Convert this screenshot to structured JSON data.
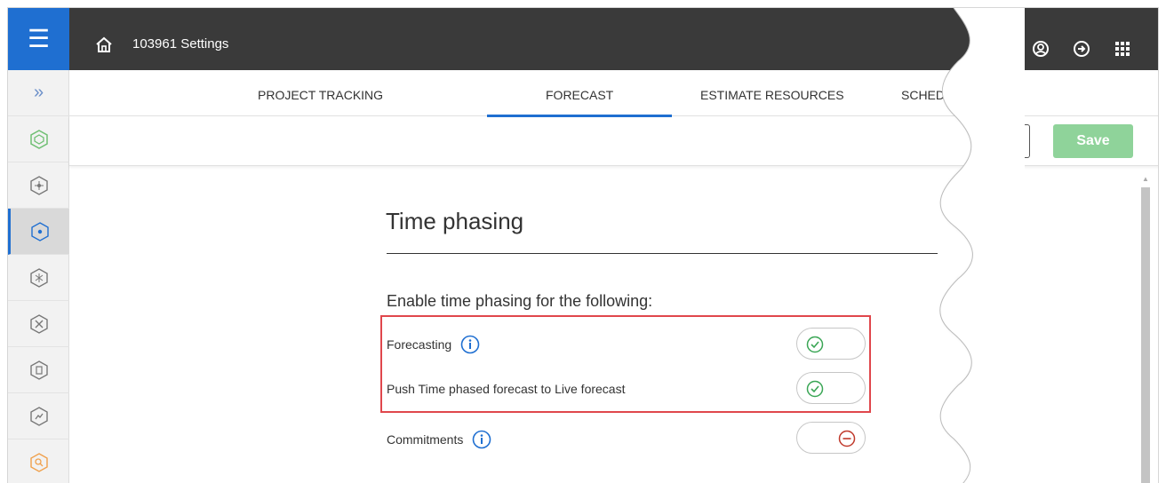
{
  "header": {
    "title": "103961 Settings"
  },
  "tabs": [
    {
      "label": "PROJECT TRACKING"
    },
    {
      "label": "FORECAST",
      "active": true
    },
    {
      "label": "ESTIMATE RESOURCES"
    },
    {
      "label": "SCHEDULE"
    }
  ],
  "toolbar": {
    "save_label": "Save"
  },
  "content": {
    "heading": "Time phasing",
    "subheading": "Enable time phasing for the following:",
    "settings": [
      {
        "label": "Forecasting",
        "info": true,
        "enabled": true
      },
      {
        "label": "Push Time phased forecast to Live forecast",
        "info": false,
        "enabled": true
      },
      {
        "label": "Commitments",
        "info": true,
        "enabled": false
      }
    ]
  },
  "colors": {
    "brand_blue": "#1f6fd1",
    "topbar": "#3a3a3a",
    "save_disabled": "#8fd39a",
    "highlight": "#e0474c",
    "toggle_on": "#3aa655",
    "toggle_off": "#c0392b"
  },
  "icons": {
    "menu": "hamburger-icon",
    "home": "home-icon",
    "user": "user-icon",
    "logout": "logout-icon",
    "apps": "grid-icon",
    "expand": "double-chevron-right-icon",
    "info": "info-icon"
  }
}
